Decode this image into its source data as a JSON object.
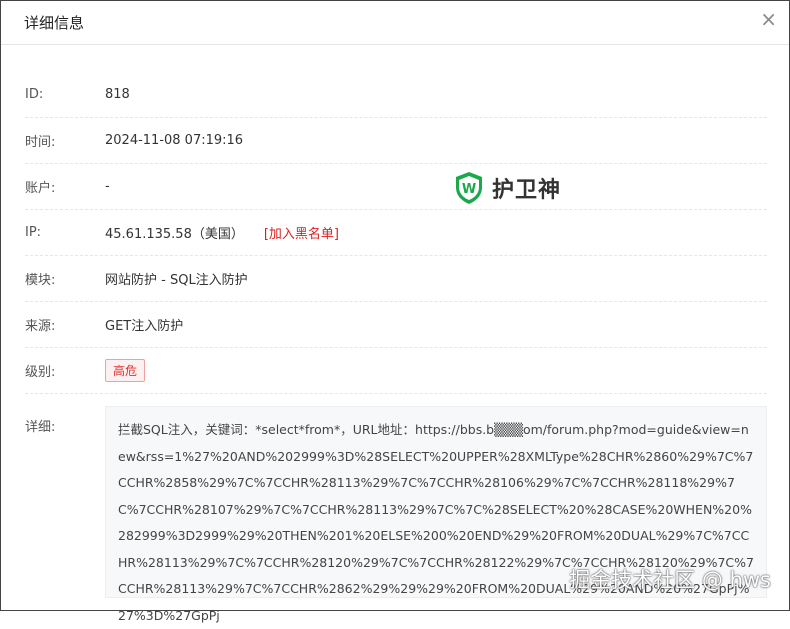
{
  "dialog": {
    "title": "详细信息",
    "close": "×"
  },
  "fields": [
    {
      "label": "ID:",
      "value": "818"
    },
    {
      "label": "时间:",
      "value": "2024-11-08 07:19:16"
    },
    {
      "label": "账户:",
      "value": "-"
    },
    {
      "label": "IP:",
      "value": "45.61.135.58（美国）",
      "action": "[加入黑名单]"
    },
    {
      "label": "模块:",
      "value": "网站防护 - SQL注入防护"
    },
    {
      "label": "来源:",
      "value": "GET注入防护"
    },
    {
      "label": "级别:",
      "value": "高危"
    }
  ],
  "detail": {
    "label": "详细:",
    "value": "拦截SQL注入，关键词：*select*from*，URL地址：https://bbs.b▒▒▒om/forum.php?mod=guide&view=new&rss=1%27%20AND%202999%3D%28SELECT%20UPPER%28XMLType%28CHR%2860%29%7C%7CCHR%2858%29%7C%7CCHR%28113%29%7C%7CCHR%28106%29%7C%7CCHR%28118%29%7C%7CCHR%28107%29%7C%7CCHR%28113%29%7C%7C%28SELECT%20%28CASE%20WHEN%20%282999%3D2999%29%20THEN%201%20ELSE%200%20END%29%20FROM%20DUAL%29%7C%7CCHR%28113%29%7C%7CCHR%28120%29%7C%7CCHR%28122%29%7C%7CCHR%28120%29%7C%7CCHR%28113%29%7C%7CCHR%2862%29%29%29%20FROM%20DUAL%29%20AND%20%27GpPj%27%3D%27GpPj"
  },
  "logo": {
    "text": "护卫神"
  },
  "watermark": "掘金技术社区 @ hws",
  "colors": {
    "danger": "#e02020",
    "brand": "#1aa84a"
  }
}
